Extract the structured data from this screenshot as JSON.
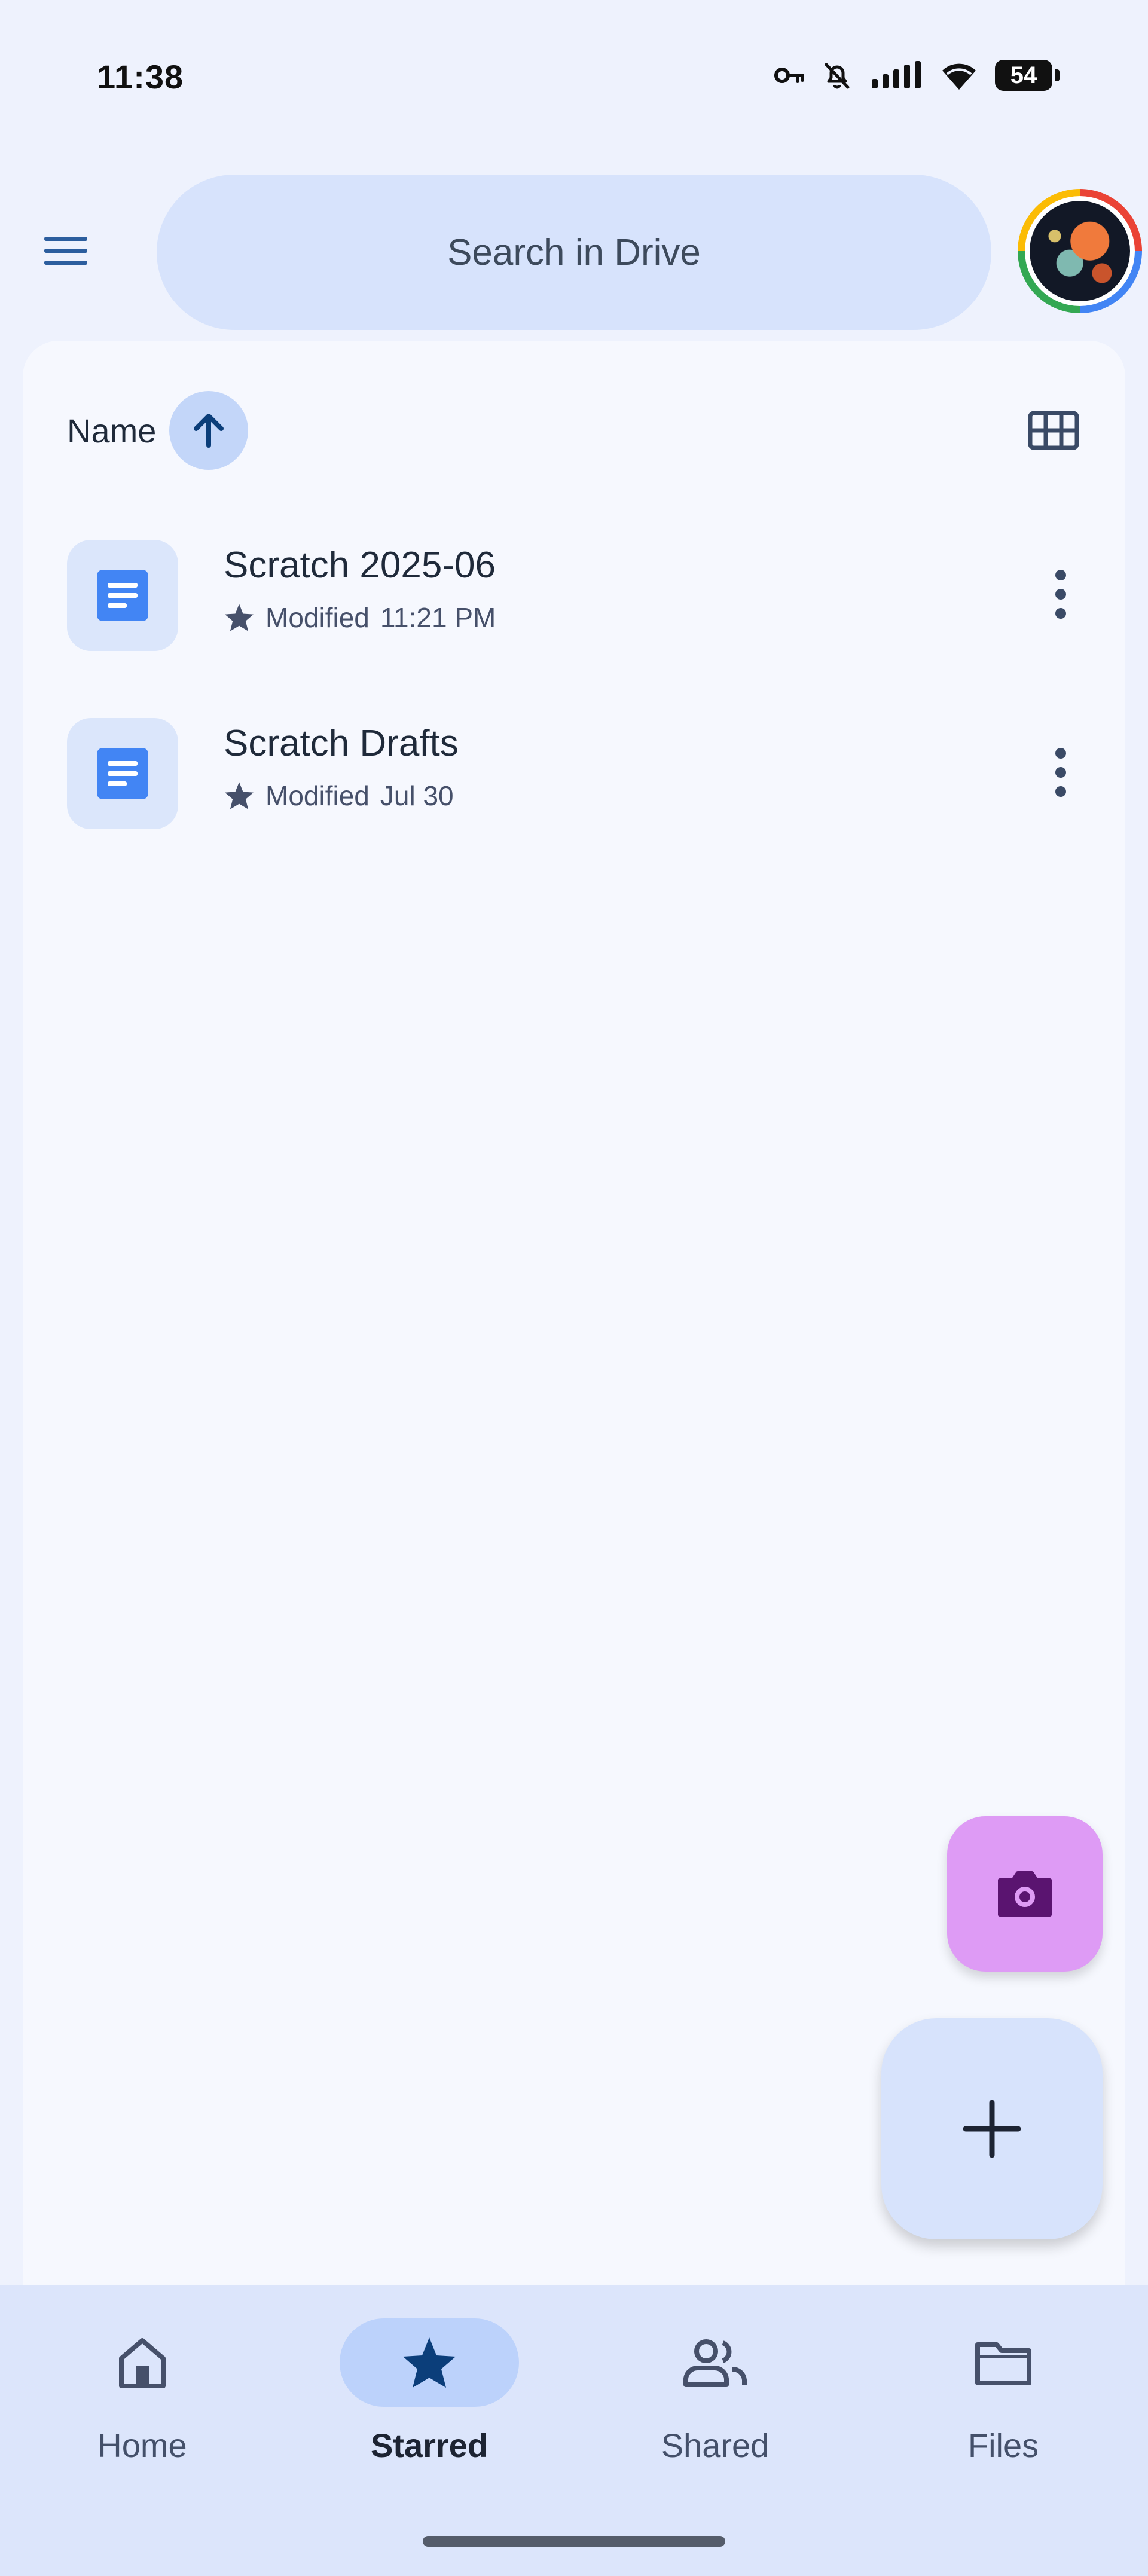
{
  "status_bar": {
    "time": "11:38",
    "battery": "54",
    "icons": [
      "vpn-key-icon",
      "mute-icon",
      "signal-icon",
      "wifi-icon",
      "battery-icon"
    ]
  },
  "header": {
    "menu_icon": "hamburger-menu-icon",
    "search_placeholder": "Search in Drive",
    "avatar_icon": "account-avatar"
  },
  "sort": {
    "label": "Name",
    "direction_icon": "arrow-up-icon",
    "view_toggle_icon": "grid-view-icon"
  },
  "files": [
    {
      "title": "Scratch 2025-06",
      "modified_label": "Modified",
      "modified_value": "11:21 PM",
      "starred": true,
      "type_icon": "google-docs-icon"
    },
    {
      "title": "Scratch Drafts",
      "modified_label": "Modified",
      "modified_value": "Jul 30",
      "starred": true,
      "type_icon": "google-docs-icon"
    }
  ],
  "fabs": {
    "camera_icon": "camera-icon",
    "new_icon": "plus-icon"
  },
  "bottom_nav": {
    "items": [
      {
        "label": "Home",
        "icon": "home-icon",
        "active": false
      },
      {
        "label": "Starred",
        "icon": "star-icon",
        "active": true
      },
      {
        "label": "Shared",
        "icon": "people-icon",
        "active": false
      },
      {
        "label": "Files",
        "icon": "folder-icon",
        "active": false
      }
    ]
  },
  "colors": {
    "background": "#EEF2FD",
    "card": "#F6F8FE",
    "search_pill": "#D7E3FC",
    "accent_blue": "#4285F4",
    "active_nav_pill": "#BCD2FB",
    "camera_fab": "#DE9BF5",
    "new_fab": "#D7E3FC"
  }
}
